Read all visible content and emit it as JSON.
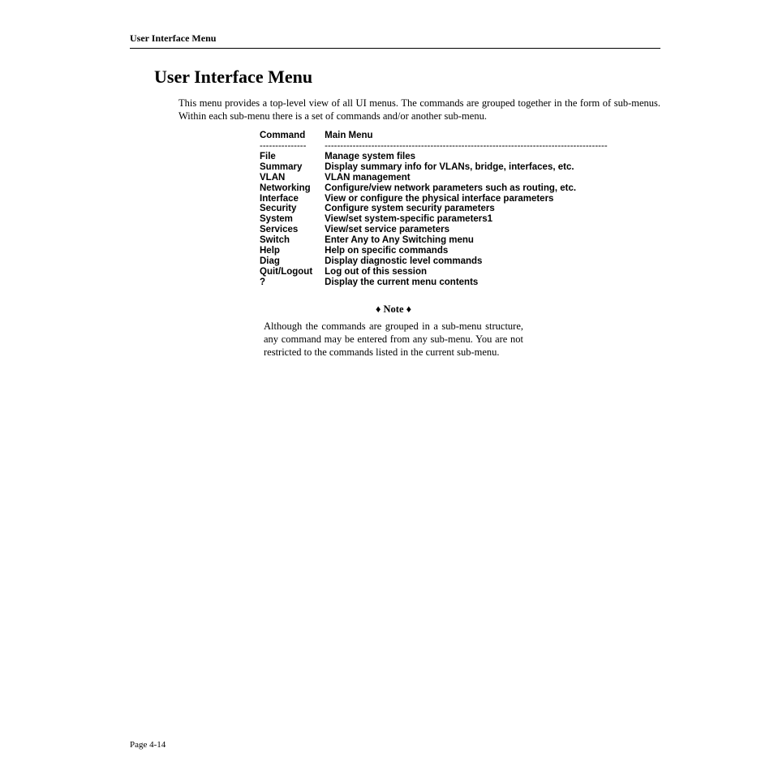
{
  "running_header": "User Interface Menu",
  "title": "User Interface Menu",
  "intro": "This menu provides a top-level view of all UI menus. The commands are grouped together in the form of sub-menus. Within each sub-menu there is a set of commands and/or another sub-menu.",
  "table": {
    "head_cmd": "Command",
    "head_desc": "Main Menu",
    "dash_cmd": "---------------",
    "dash_desc": "-------------------------------------------------------------------------------------------",
    "rows": [
      {
        "cmd": "File",
        "desc": "Manage system files"
      },
      {
        "cmd": "Summary",
        "desc": "Display summary info for VLANs, bridge, interfaces, etc."
      },
      {
        "cmd": "VLAN",
        "desc": "VLAN management"
      },
      {
        "cmd": "Networking",
        "desc": "Configure/view network parameters such as routing, etc."
      },
      {
        "cmd": "Interface",
        "desc": "View or configure the physical interface parameters"
      },
      {
        "cmd": "Security",
        "desc": "Configure system security parameters"
      },
      {
        "cmd": "System",
        "desc": "View/set system-specific parameters1"
      },
      {
        "cmd": "Services",
        "desc": "View/set service parameters"
      },
      {
        "cmd": "Switch",
        "desc": "Enter Any to Any Switching menu"
      },
      {
        "cmd": "Help",
        "desc": "Help on specific commands"
      },
      {
        "cmd": "Diag",
        "desc": "Display diagnostic level commands"
      },
      {
        "cmd": "Quit/Logout",
        "desc": "Log out of this session"
      },
      {
        "cmd": "?",
        "desc": "Display the current menu contents"
      }
    ]
  },
  "note": {
    "label": "♦ Note ♦",
    "body": "Although the commands are grouped in a sub-menu structure, any command may be entered from any sub-menu. You are not restricted to the commands listed in the current sub-menu."
  },
  "page_footer": "Page 4-14"
}
